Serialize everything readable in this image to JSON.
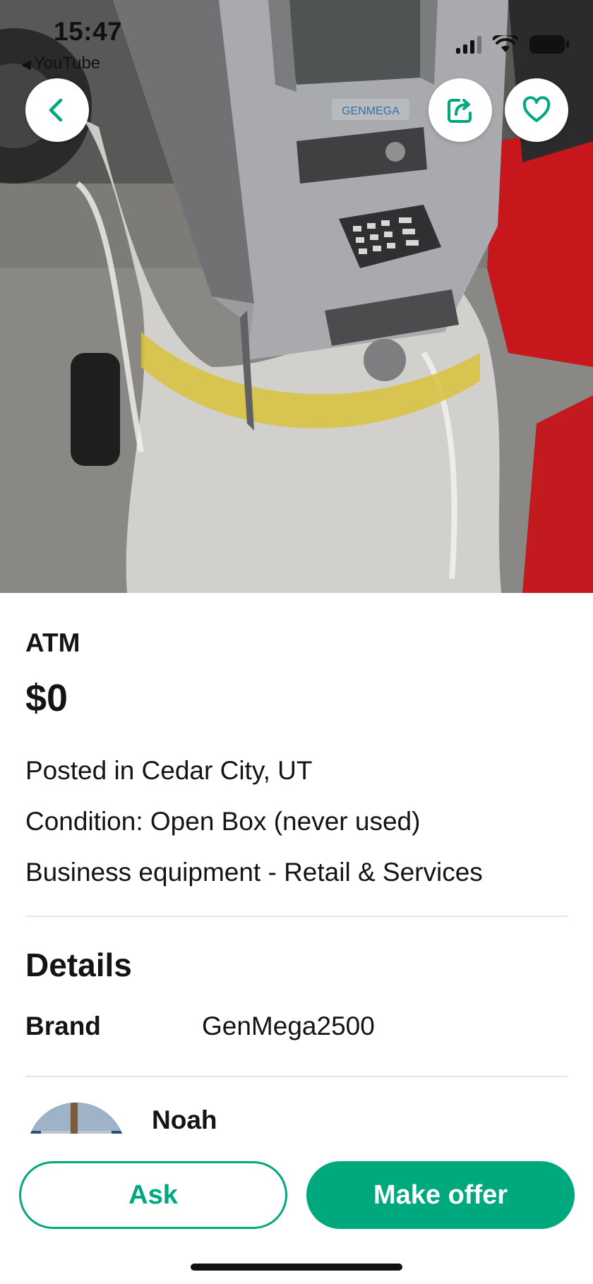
{
  "status_bar": {
    "time": "15:47",
    "back_app": "YouTube",
    "icons": [
      "cellular-signal-icon",
      "wifi-icon",
      "battery-icon"
    ]
  },
  "hero_image": {
    "subject": "ATM machine wrapped in plastic",
    "brand_text_on_machine": "GENMEGA",
    "buttons": [
      "back-chevron-icon",
      "share-icon",
      "heart-icon"
    ]
  },
  "listing": {
    "title": "ATM",
    "price": "$0",
    "location": "Posted in Cedar City, UT",
    "condition": "Condition: Open Box (never used)",
    "category": "Business equipment - Retail & Services"
  },
  "details": {
    "heading": "Details",
    "rows": [
      {
        "label": "Brand",
        "value": "GenMega2500"
      }
    ]
  },
  "seller": {
    "name": "Noah"
  },
  "actions": {
    "ask_label": "Ask",
    "offer_label": "Make offer"
  },
  "colors": {
    "accent": "#00a87e",
    "text": "#141414",
    "divider": "#e6e6e6"
  }
}
